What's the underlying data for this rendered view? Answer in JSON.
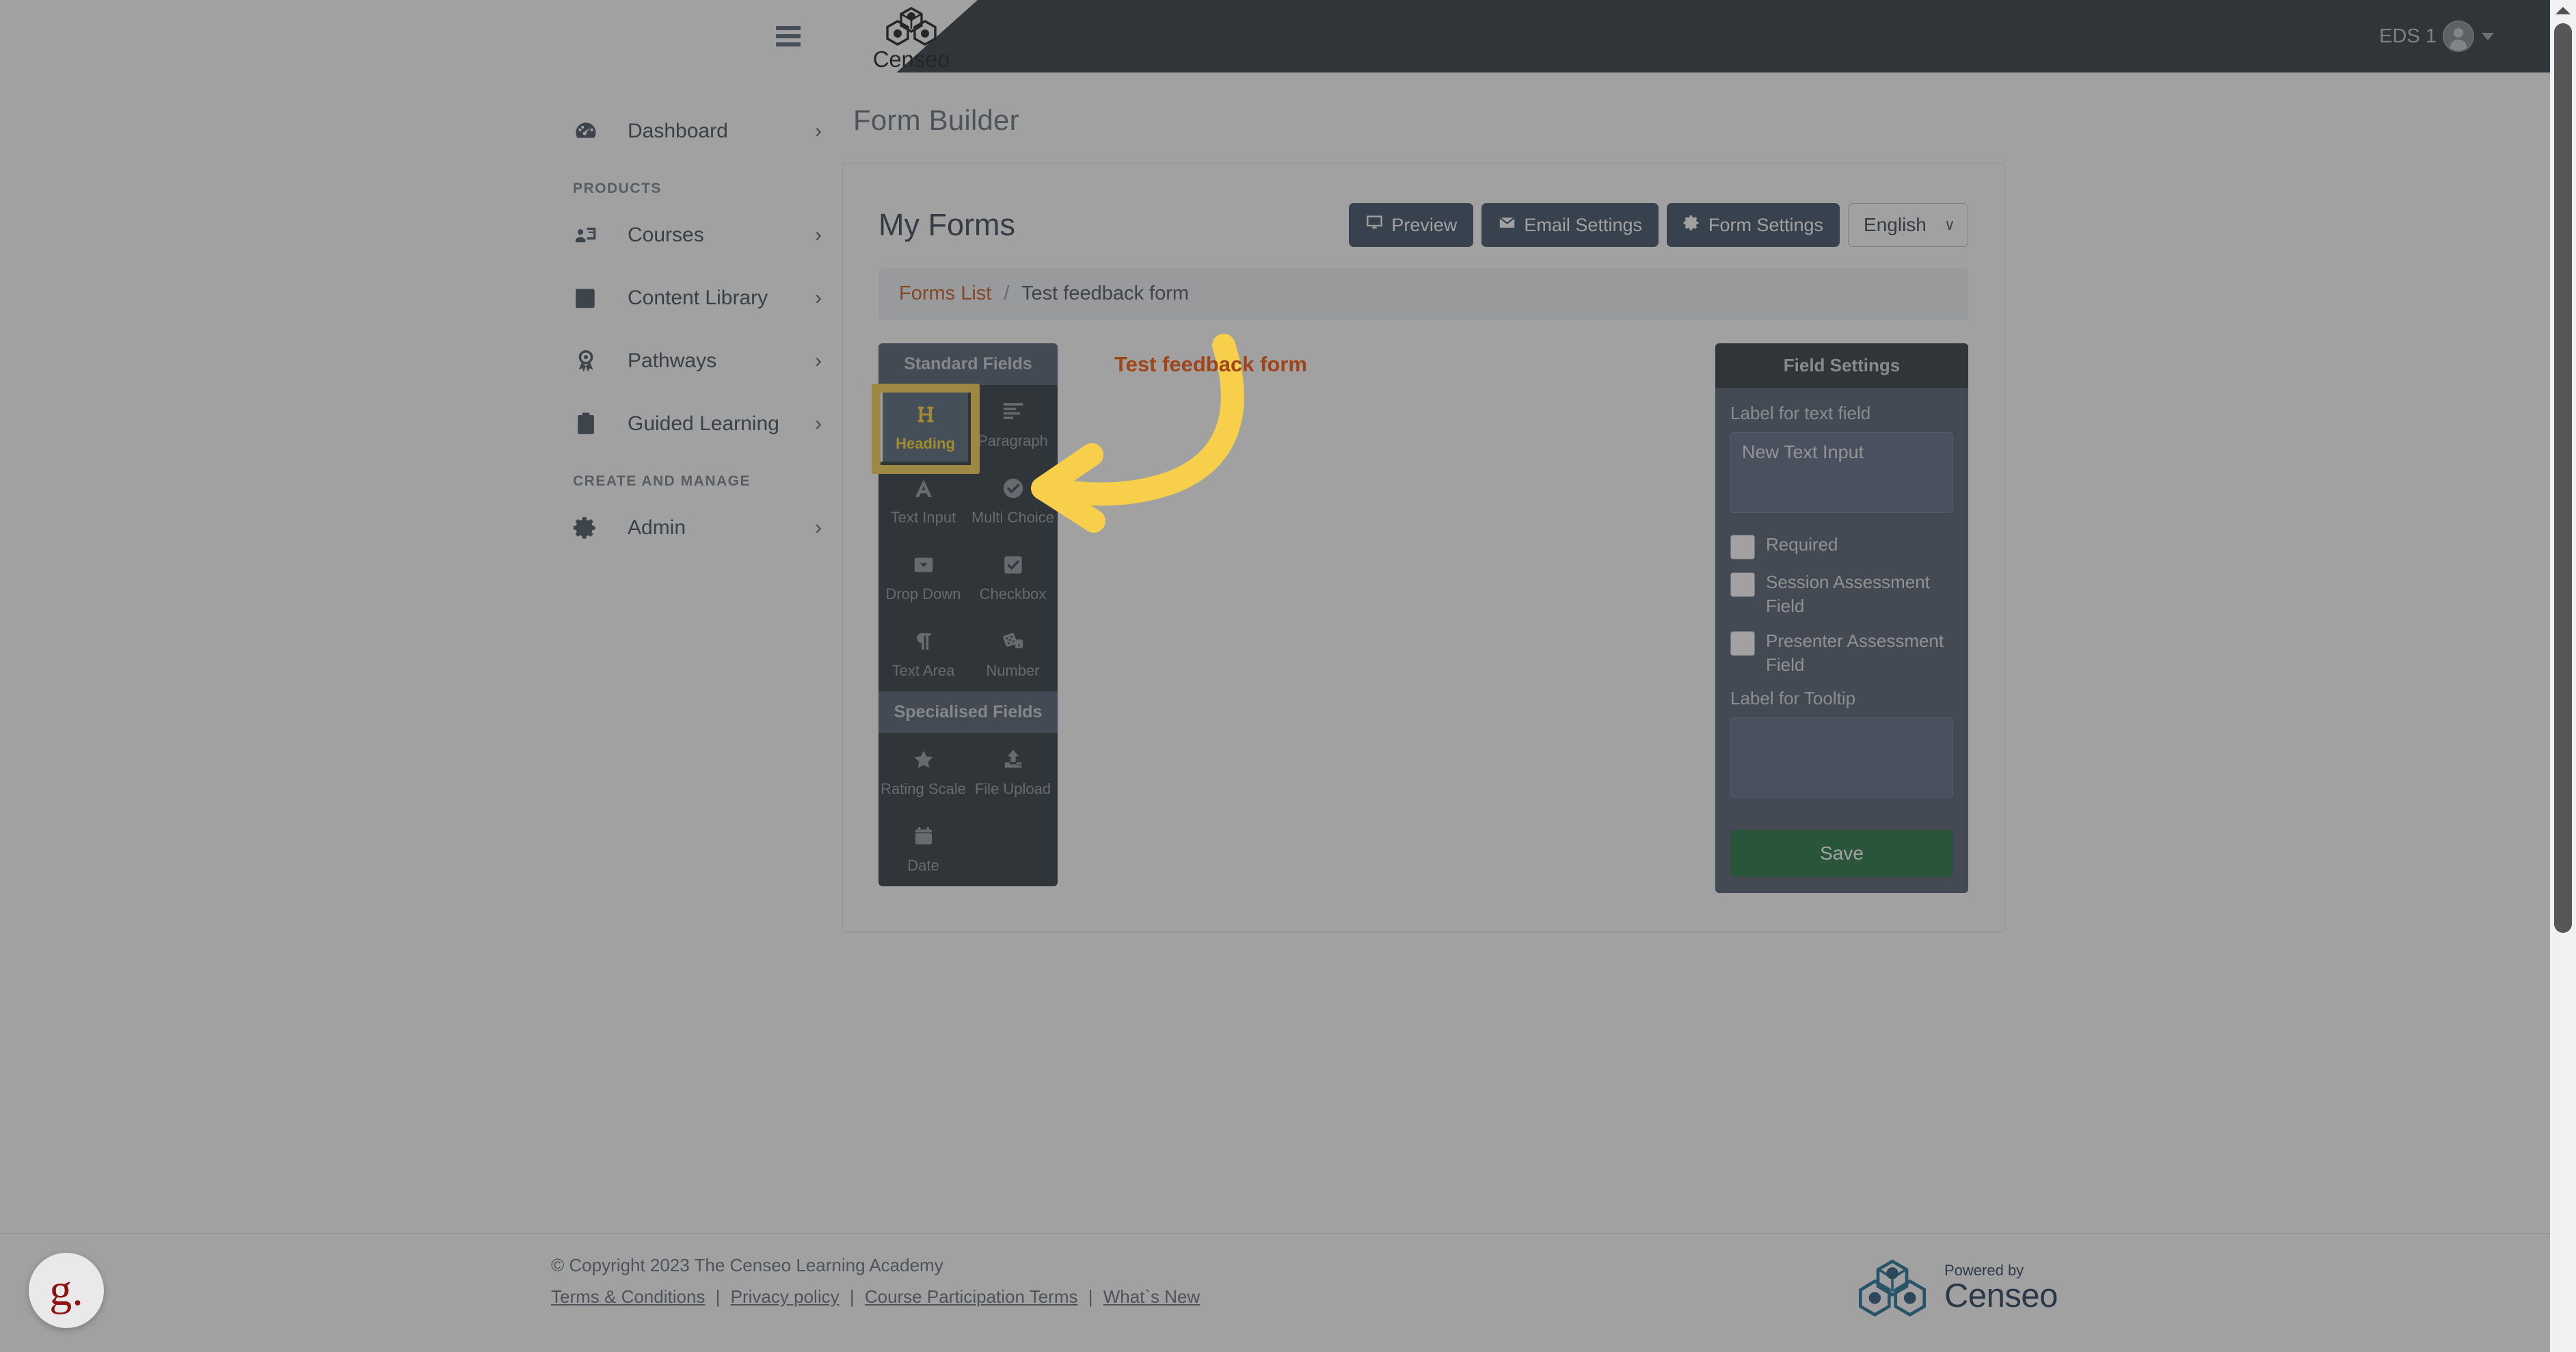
{
  "topbar": {
    "brand_name": "Censeo",
    "menu_icon": "hamburger-icon",
    "user_name": "EDS 1"
  },
  "sidebar": {
    "groups": [
      {
        "title": "",
        "items": [
          {
            "label": "Dashboard",
            "icon": "dashboard-icon"
          }
        ]
      },
      {
        "title": "PRODUCTS",
        "items": [
          {
            "label": "Courses",
            "icon": "courses-icon"
          },
          {
            "label": "Content Library",
            "icon": "book-icon"
          },
          {
            "label": "Pathways",
            "icon": "award-icon"
          },
          {
            "label": "Guided Learning",
            "icon": "clipboard-list-icon"
          }
        ]
      },
      {
        "title": "CREATE AND MANAGE",
        "items": [
          {
            "label": "Admin",
            "icon": "gear-icon"
          }
        ]
      }
    ],
    "chevron": "›"
  },
  "main": {
    "page_title": "Form Builder",
    "card_title": "My Forms",
    "actions": [
      {
        "label": "Preview",
        "icon": "monitor-icon"
      },
      {
        "label": "Email Settings",
        "icon": "envelope-icon"
      },
      {
        "label": "Form Settings",
        "icon": "gear-icon"
      }
    ],
    "language_select": {
      "value": "English",
      "caret": "∨",
      "options": [
        "English"
      ]
    },
    "breadcrumb": {
      "link": "Forms List",
      "separator": "/",
      "current": "Test feedback form"
    }
  },
  "palette": {
    "sections": [
      {
        "heading": "Standard Fields",
        "items": [
          {
            "label": "Heading",
            "icon": "heading-h-icon",
            "selected": true
          },
          {
            "label": "Paragraph",
            "icon": "paragraph-lines-icon",
            "selected": false
          },
          {
            "label": "Text Input",
            "icon": "letter-a-icon",
            "selected": false
          },
          {
            "label": "Multi Choice",
            "icon": "check-circle-icon",
            "selected": false
          },
          {
            "label": "Drop Down",
            "icon": "dropdown-caret-icon",
            "selected": false
          },
          {
            "label": "Checkbox",
            "icon": "checkbox-icon",
            "selected": false
          },
          {
            "label": "Text Area",
            "icon": "pilcrow-icon",
            "selected": false
          },
          {
            "label": "Number",
            "icon": "dice-icon",
            "selected": false
          }
        ]
      },
      {
        "heading": "Specialised Fields",
        "items": [
          {
            "label": "Rating Scale",
            "icon": "star-icon",
            "selected": false
          },
          {
            "label": "File Upload",
            "icon": "upload-icon",
            "selected": false
          },
          {
            "label": "Date",
            "icon": "calendar-icon",
            "selected": false
          }
        ]
      }
    ]
  },
  "field_settings": {
    "title": "Field Settings",
    "label_text_field": "Label for text field",
    "label_text_value": "New Text Input",
    "checkboxes": [
      {
        "label": "Required",
        "checked": false
      },
      {
        "label": "Session Assessment Field",
        "checked": false
      },
      {
        "label": "Presenter Assessment Field",
        "checked": false
      }
    ],
    "label_tooltip": "Label for Tooltip",
    "tooltip_value": "",
    "save_label": "Save"
  },
  "annotation": {
    "text": "Test feedback form",
    "arrow_color": "#f7cf4a",
    "text_color": "#a0441a",
    "highlight_color": "#f7cf4a"
  },
  "footer": {
    "copyright": "© Copyright 2023 The Censeo Learning Academy",
    "links": [
      "Terms & Conditions",
      "Privacy policy",
      "Course Participation Terms",
      "What`s New"
    ],
    "separator": "|",
    "powered_by": "Powered by",
    "brand": "Censeo"
  },
  "help_widget": {
    "glyph": "g."
  },
  "scrollbar": {
    "up_arrow": "scroll-up-arrow"
  }
}
